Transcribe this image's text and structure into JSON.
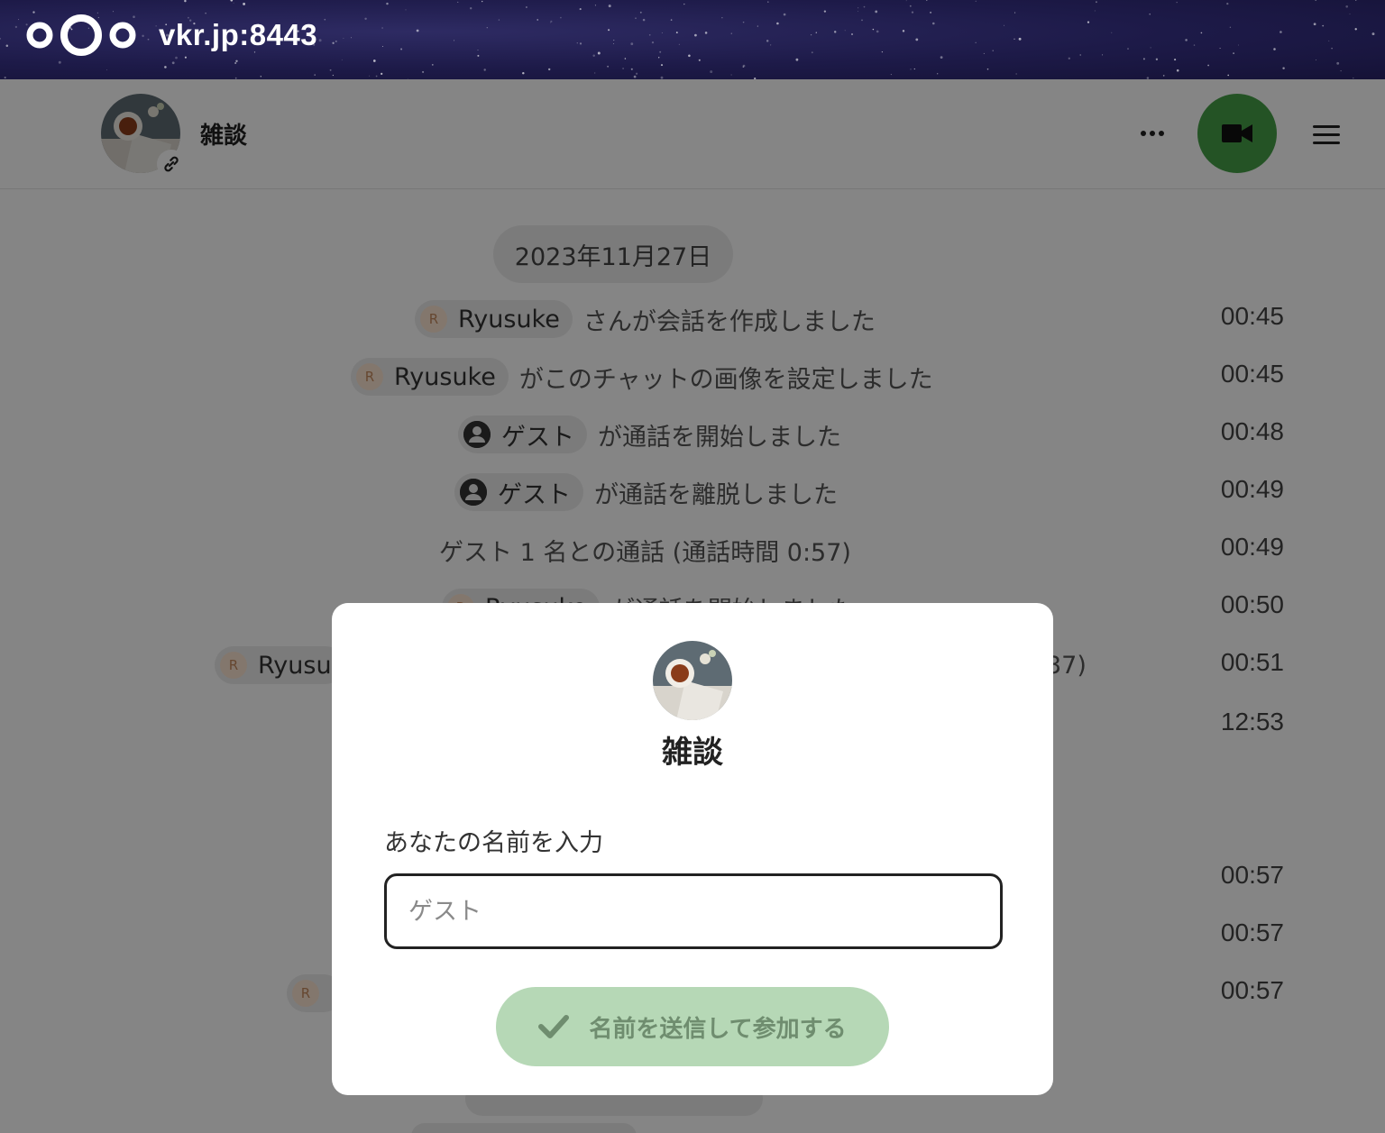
{
  "topbar": {
    "server": "vkr.jp:8443",
    "logo_icon": "nextcloud-logo"
  },
  "header": {
    "title": "雑談",
    "call_icon": "video-camera-icon"
  },
  "chat": {
    "date": "2023年11月27日",
    "messages": [
      {
        "actor": "Ryusuke",
        "text": "さんが会話を作成しました",
        "time": "00:45"
      },
      {
        "actor": "Ryusuke",
        "text": "がこのチャットの画像を設定しました",
        "time": "00:45"
      },
      {
        "actor": "ゲスト",
        "text": "が通話を開始しました",
        "time": "00:48"
      },
      {
        "actor": "ゲスト",
        "text": "が通話を離脱しました",
        "time": "00:49"
      },
      {
        "actor": "",
        "text": "ゲスト 1 名との通話 (通話時間 0:57)",
        "time": "00:49"
      },
      {
        "actor": "Ryusuke",
        "text": "が通話を開始しました",
        "time": "00:50"
      },
      {
        "actor": "Ryusu",
        "text": "",
        "trail": "37)",
        "time": "00:51"
      },
      {
        "actor": "",
        "text": "",
        "time": "12:53"
      },
      {
        "actor": "",
        "text": "",
        "time": "00:57"
      },
      {
        "actor": "",
        "text": "",
        "time": "00:57"
      },
      {
        "actor": "R",
        "text": "",
        "time": "00:57"
      }
    ]
  },
  "modal": {
    "title": "雑談",
    "label": "あなたの名前を入力",
    "input_placeholder": "ゲスト",
    "submit_label": "名前を送信して参加する"
  },
  "colors": {
    "call_button": "#46a047",
    "submit_button": "#b6d8b6"
  }
}
